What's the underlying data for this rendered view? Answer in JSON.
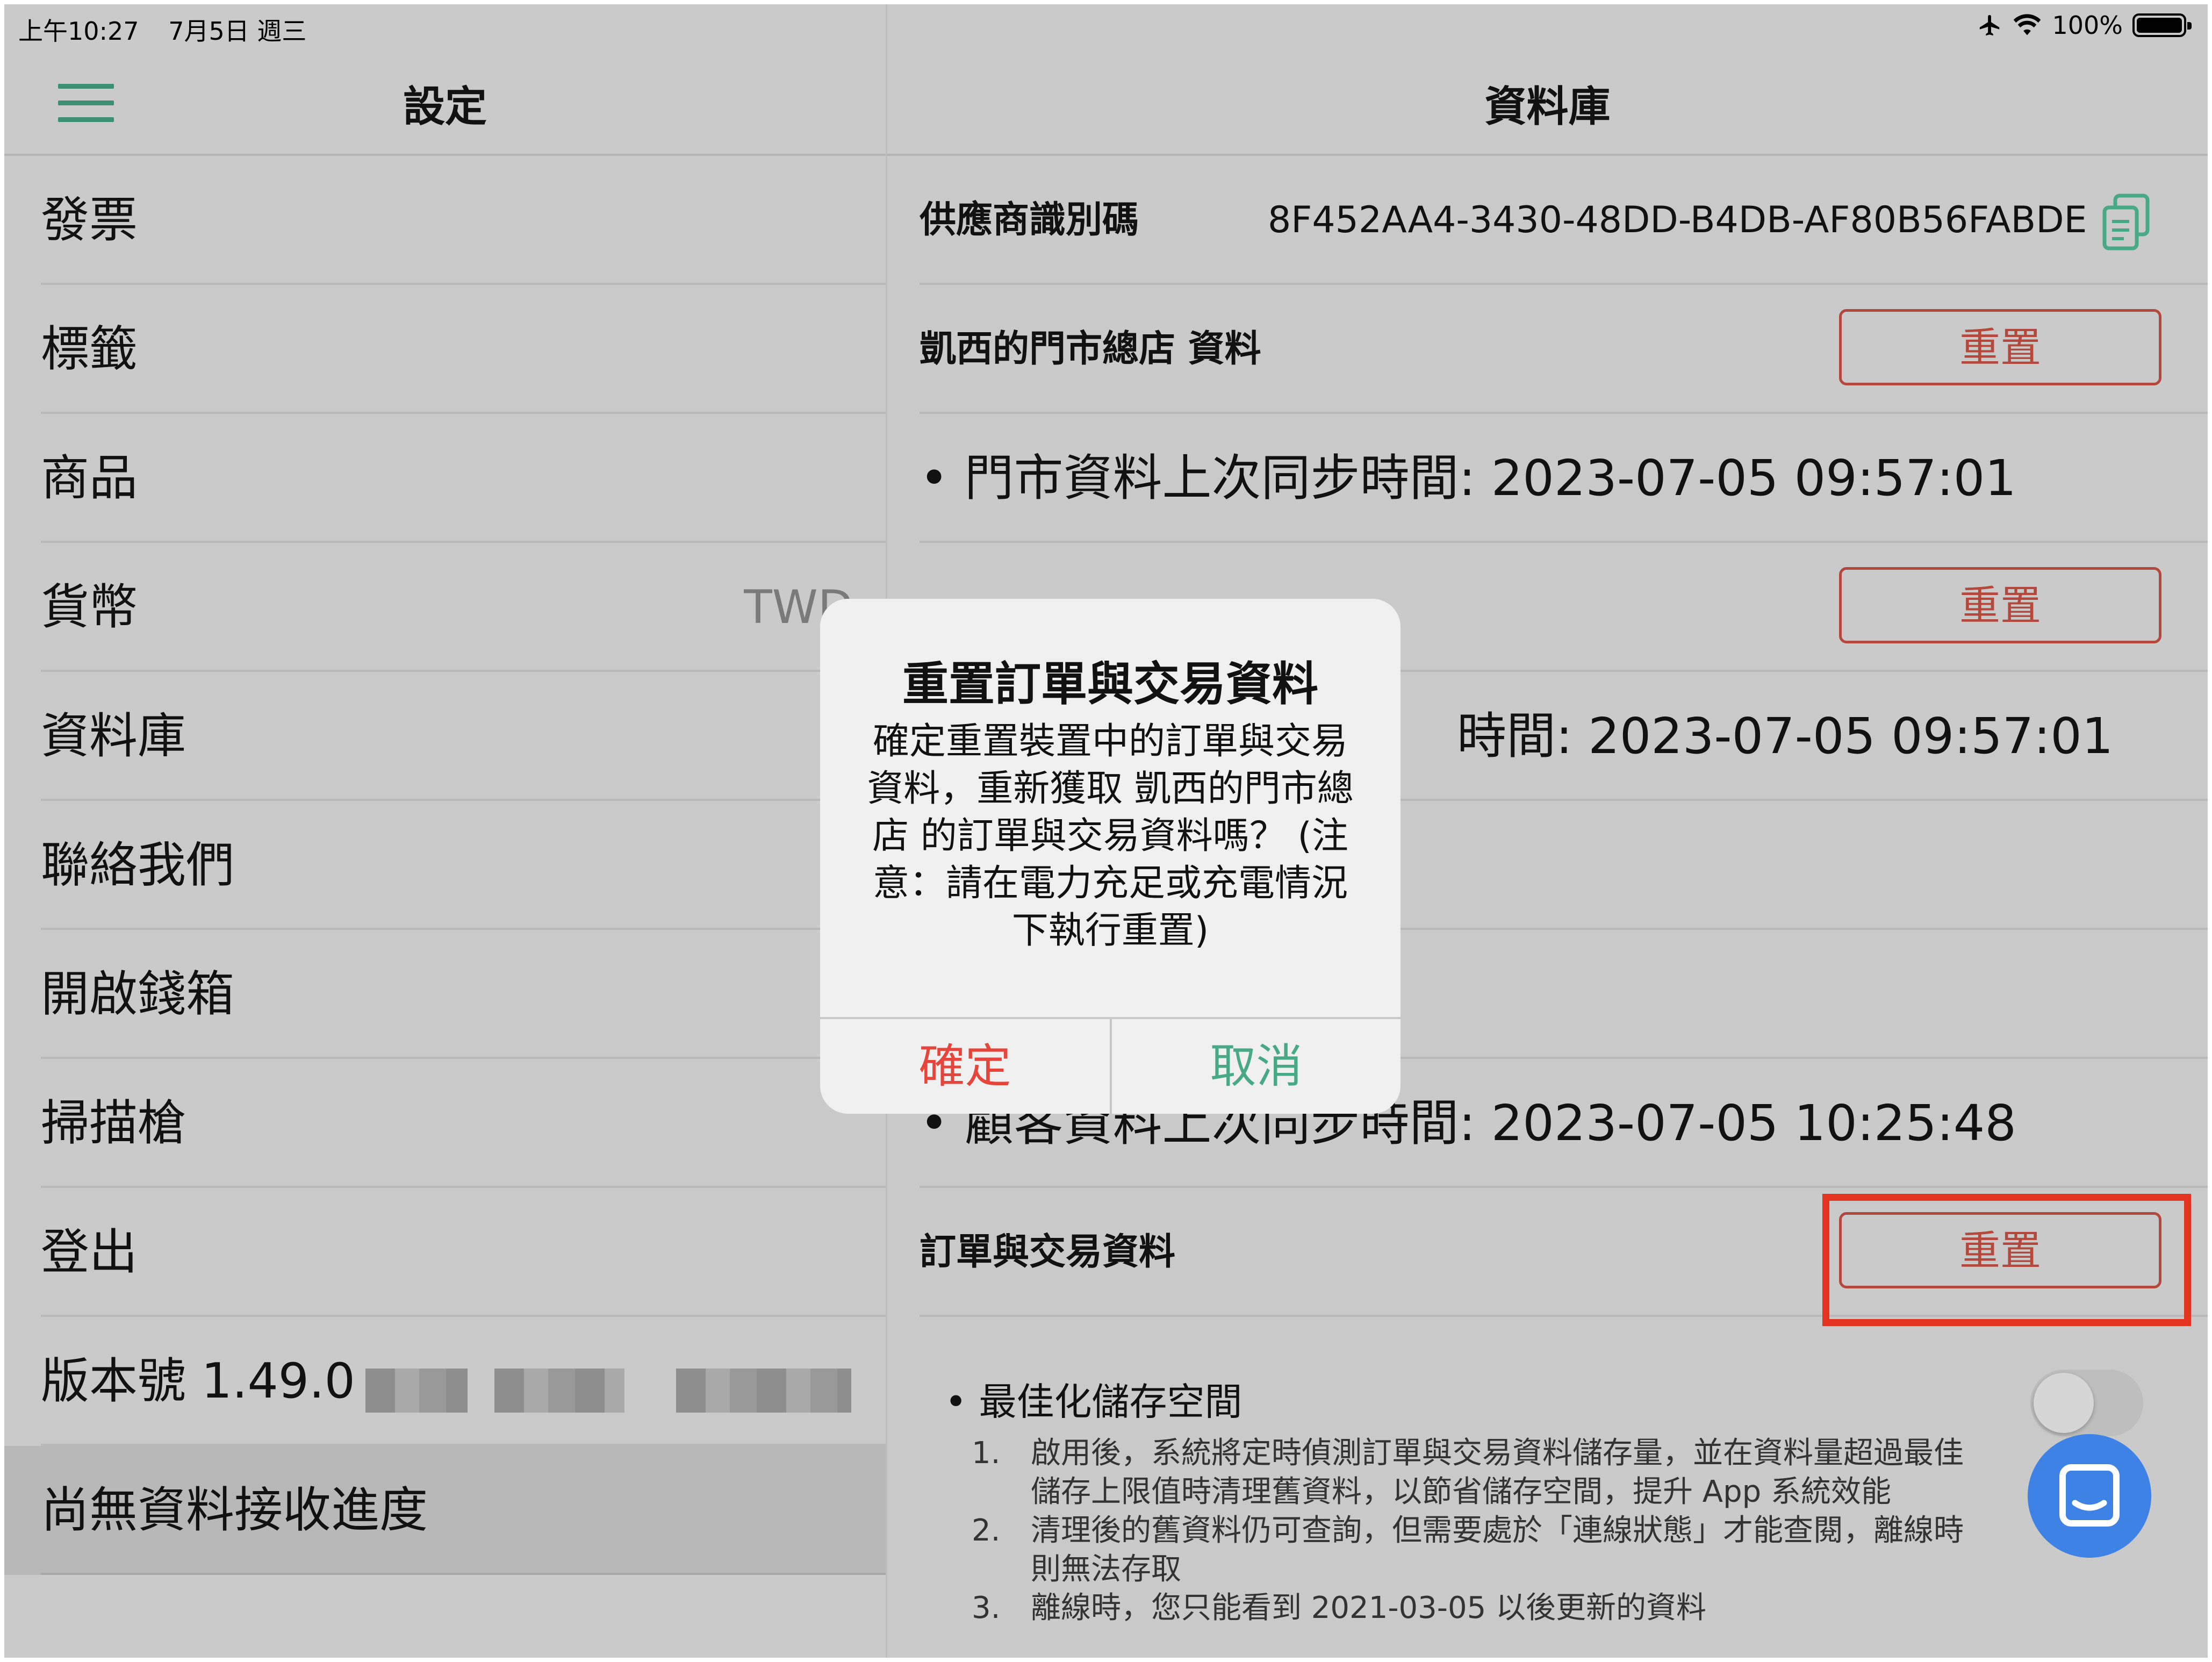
{
  "status_bar": {
    "time": "上午10:27",
    "date": "7月5日 週三",
    "battery": "100%"
  },
  "left_pane": {
    "title": "設定",
    "items": [
      {
        "label": "發票"
      },
      {
        "label": "標籤"
      },
      {
        "label": "商品"
      },
      {
        "label": "貨幣",
        "value": "TWD"
      },
      {
        "label": "資料庫"
      },
      {
        "label": "聯絡我們"
      },
      {
        "label": "開啟錢箱"
      },
      {
        "label": "掃描槍"
      },
      {
        "label": "登出"
      },
      {
        "label": "版本號 1.49.0"
      }
    ],
    "sync_status": "尚無資料接收進度"
  },
  "right_pane": {
    "title": "資料庫",
    "vendor_id_label": "供應商識別碼",
    "vendor_id_value": "8F452AA4-3430-48DD-B4DB-AF80B56FABDE",
    "store_section_label": "凱西的門市總店 資料",
    "store_sync_text": "• 門市資料上次同步時間: 2023-07-05 09:57:01",
    "product_sync_text": "時間: 2023-07-05 09:57:01",
    "customer_sync_text": "• 顧客資料上次同步時間: 2023-07-05 10:25:48",
    "orders_section_label": "訂單與交易資料",
    "reset_label": "重置",
    "optimize_title": "• 最佳化儲存空間",
    "optimize_notes": [
      {
        "num": "1.",
        "text": "啟用後，系統將定時偵測訂單與交易資料儲存量，並在資料量超過最佳儲存上限值時清理舊資料，以節省儲存空間，提升 App 系統效能"
      },
      {
        "num": "2.",
        "text": "清理後的舊資料仍可查詢，但需要處於「連線狀態」才能查閱，離線時則無法存取"
      },
      {
        "num": "3.",
        "text": "離線時，您只能看到 2021-03-05 以後更新的資料"
      }
    ],
    "optimize_enabled": false
  },
  "dialog": {
    "title": "重置訂單與交易資料",
    "message": "確定重置裝置中的訂單與交易資料，重新獲取 凱西的門市總店 的訂單與交易資料嗎？ (注意：請在電力充足或充電情況下執行重置)",
    "confirm_label": "確定",
    "cancel_label": "取消"
  },
  "colors": {
    "accent_green": "#48a987",
    "reset_red": "#b5483c",
    "confirm_red": "#e5453a",
    "highlight_red": "#e4341f",
    "chat_blue": "#3f82e6"
  }
}
